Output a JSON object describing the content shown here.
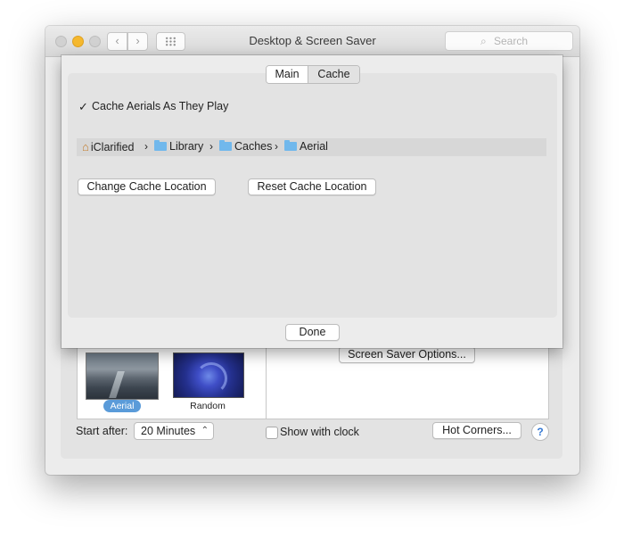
{
  "window": {
    "title": "Desktop & Screen Saver",
    "search_placeholder": "Search"
  },
  "sheet": {
    "tabs": [
      {
        "label": "Main",
        "selected": false
      },
      {
        "label": "Cache",
        "selected": true
      }
    ],
    "cache_checkbox_label": "Cache Aerials As They Play",
    "cache_checkbox_checked": true,
    "path": [
      "iClarified",
      "Library",
      "Caches",
      "Aerial"
    ],
    "change_location_label": "Change Cache Location",
    "reset_location_label": "Reset Cache Location",
    "done_label": "Done"
  },
  "background": {
    "screen_saver_options_label": "Screen Saver Options...",
    "thumbnails": [
      {
        "label": "Aerial",
        "selected": true
      },
      {
        "label": "Random",
        "selected": false
      }
    ],
    "start_after_label": "Start after:",
    "start_after_value": "20 Minutes",
    "show_clock_label": "Show with clock",
    "show_clock_checked": false,
    "hot_corners_label": "Hot Corners...",
    "help_label": "?"
  },
  "colors": {
    "selection_blue": "#5a9bd9",
    "folder_blue": "#71b8ec",
    "minimize_yellow": "#f5b82e"
  }
}
